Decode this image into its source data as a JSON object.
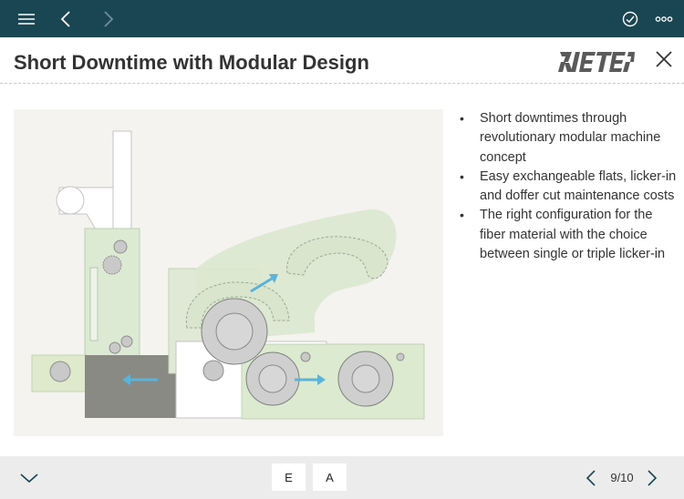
{
  "colors": {
    "topbar": "#1a4654",
    "accent_arrow": "#5bb3d9",
    "machine_green": "#cfe3c4",
    "footer": "#ececec"
  },
  "topbar": {
    "menu_icon": "hamburger-menu-icon",
    "back_icon": "chevron-left-icon",
    "forward_icon": "chevron-right-icon",
    "check_icon": "check-circle-icon",
    "more_icon": "more-dots-icon"
  },
  "header": {
    "title": "Short Downtime with Modular Design",
    "logo_text": "RIETER",
    "close_icon": "close-icon"
  },
  "content": {
    "image": "modular-card-machine-illustration",
    "bullets": [
      "Short downtimes through revolutionary modular machine concept",
      "Easy exchangeable flats, licker-in and doffer cut maintenance costs",
      "The right configuration for the fiber material with the choice between single or triple licker-in"
    ]
  },
  "footer": {
    "collapse_icon": "chevron-down-icon",
    "lang_e": "E",
    "lang_a": "A",
    "prev_icon": "chevron-left-icon",
    "page_indicator": "9/10",
    "next_icon": "chevron-right-icon"
  }
}
